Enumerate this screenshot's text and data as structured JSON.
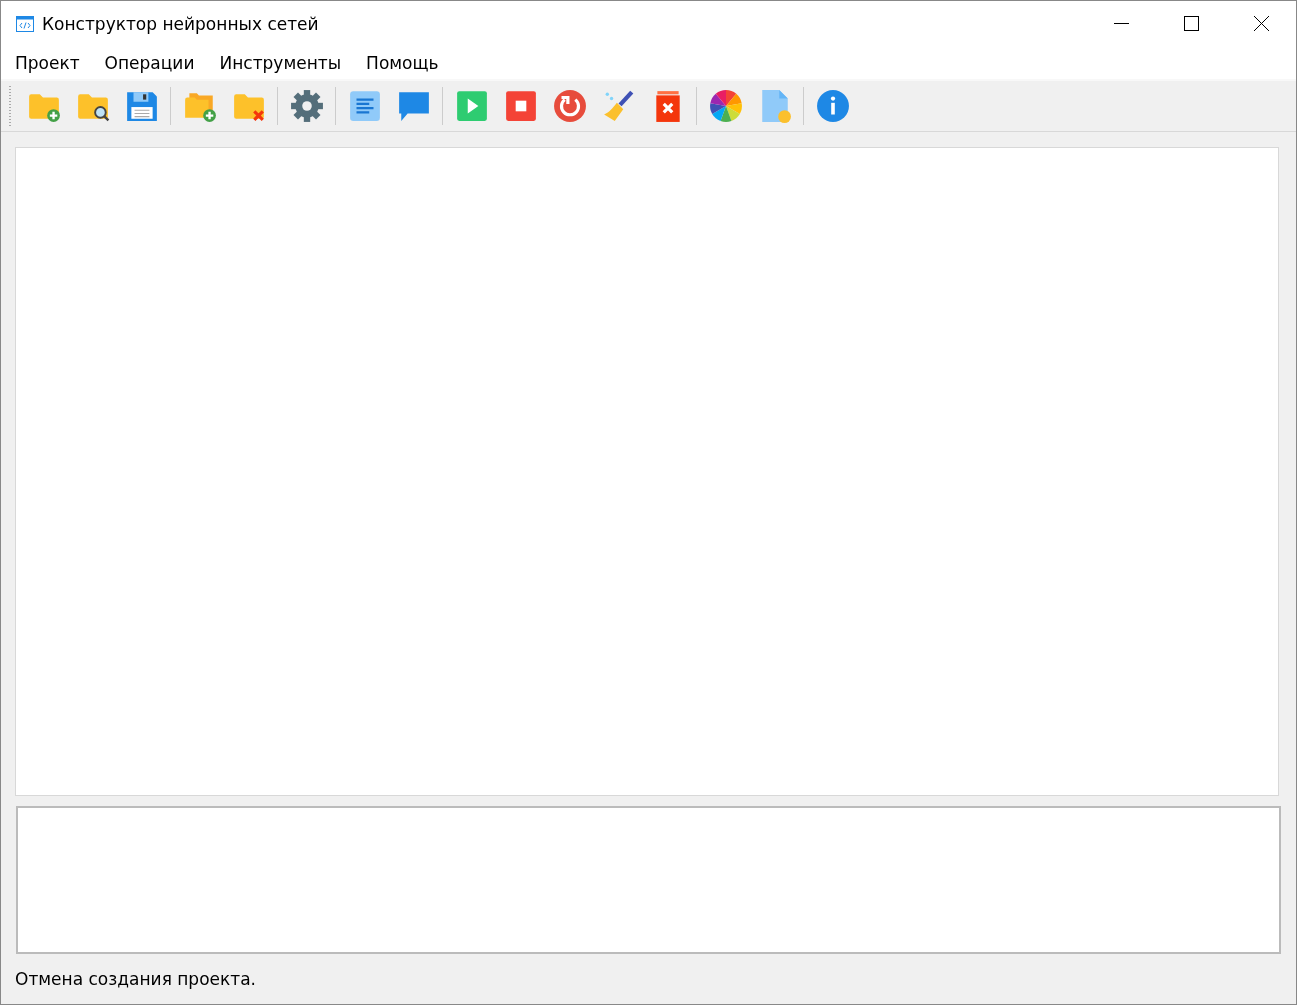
{
  "window": {
    "title": "Конструктор нейронных сетей"
  },
  "menu": [
    {
      "label": "Проект"
    },
    {
      "label": "Операции"
    },
    {
      "label": "Инструменты"
    },
    {
      "label": "Помощь"
    }
  ],
  "status_bar": "Отмена создания проекта."
}
